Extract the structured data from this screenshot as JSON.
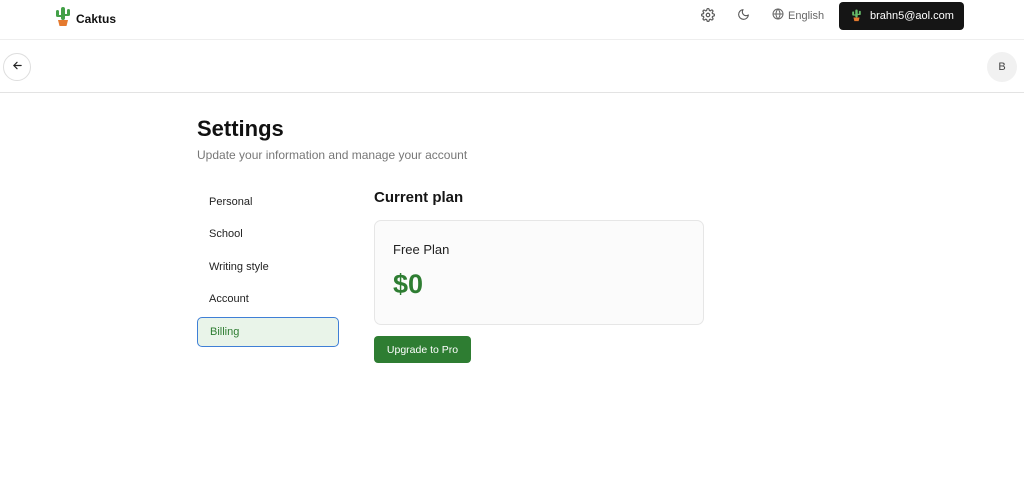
{
  "app": {
    "name": "Caktus"
  },
  "topbar": {
    "settings_icon": "gear-icon",
    "theme_icon": "moon-icon",
    "language_icon": "globe-icon",
    "language": "English",
    "user_email": "brahn5@aol.com"
  },
  "subbar": {
    "back_icon": "arrow-left-icon",
    "avatar_initial": "B"
  },
  "settings": {
    "title": "Settings",
    "subtitle": "Update your information and manage your account",
    "nav": [
      {
        "label": "Personal",
        "active": false
      },
      {
        "label": "School",
        "active": false
      },
      {
        "label": "Writing style",
        "active": false
      },
      {
        "label": "Account",
        "active": false
      },
      {
        "label": "Billing",
        "active": true
      }
    ]
  },
  "billing": {
    "section_title": "Current plan",
    "plan_name": "Free Plan",
    "plan_price": "$0",
    "upgrade_label": "Upgrade to Pro"
  },
  "colors": {
    "accent_green": "#2e7d32",
    "active_bg": "#e9f4e9",
    "focus_border": "#3f7fd6",
    "dark_button": "#151515"
  }
}
